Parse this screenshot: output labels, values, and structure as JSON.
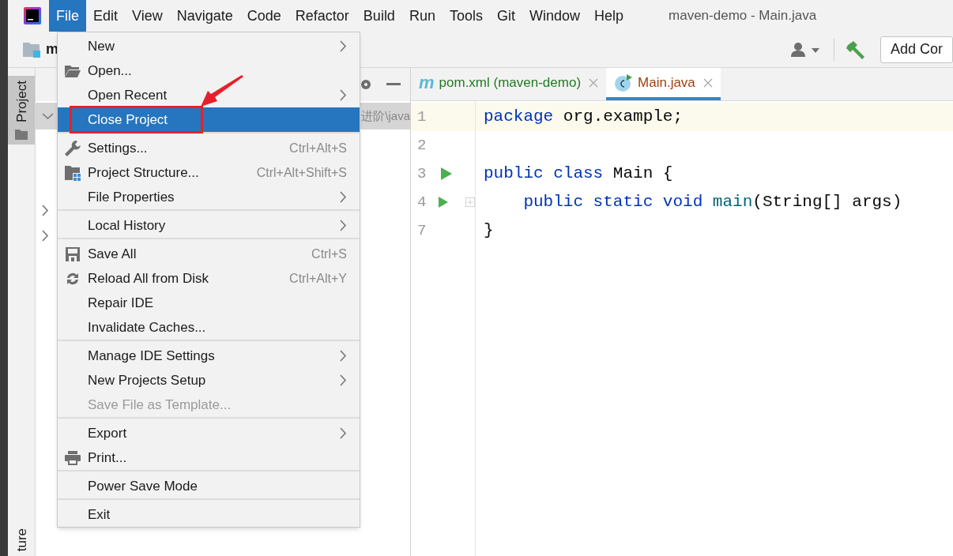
{
  "window": {
    "title": "maven-demo - Main.java"
  },
  "menu_bar": [
    {
      "label": "File",
      "selected": true
    },
    {
      "label": "Edit",
      "selected": false
    },
    {
      "label": "View",
      "selected": false
    },
    {
      "label": "Navigate",
      "selected": false
    },
    {
      "label": "Code",
      "selected": false
    },
    {
      "label": "Refactor",
      "selected": false
    },
    {
      "label": "Build",
      "selected": false
    },
    {
      "label": "Run",
      "selected": false
    },
    {
      "label": "Tools",
      "selected": false
    },
    {
      "label": "Git",
      "selected": false
    },
    {
      "label": "Window",
      "selected": false
    },
    {
      "label": "Help",
      "selected": false
    }
  ],
  "toolbar": {
    "project_name": "m",
    "run_config_button": "Add Cor"
  },
  "side_tabs": [
    {
      "label": "Project",
      "selected": true
    },
    {
      "label": "ture",
      "selected": false
    }
  ],
  "project_panel": {
    "path_fragment": "进阶\\java"
  },
  "file_menu": {
    "groups": [
      [
        {
          "label": "New",
          "submenu": true,
          "disabled": false,
          "selected": false
        },
        {
          "label": "Open...",
          "kind": "folder",
          "submenu": false,
          "disabled": false,
          "selected": false
        },
        {
          "label": "Open Recent",
          "submenu": true,
          "disabled": false,
          "selected": false
        },
        {
          "label": "Close Project",
          "submenu": false,
          "disabled": false,
          "selected": true
        }
      ],
      [
        {
          "label": "Settings...",
          "kind": "wrench",
          "shortcut": "Ctrl+Alt+S",
          "submenu": false,
          "disabled": false,
          "selected": false
        },
        {
          "label": "Project Structure...",
          "kind": "structure",
          "shortcut": "Ctrl+Alt+Shift+S",
          "submenu": false,
          "disabled": false,
          "selected": false
        },
        {
          "label": "File Properties",
          "submenu": true,
          "disabled": false,
          "selected": false
        }
      ],
      [
        {
          "label": "Local History",
          "submenu": true,
          "disabled": false,
          "selected": false
        }
      ],
      [
        {
          "label": "Save All",
          "kind": "save",
          "shortcut": "Ctrl+S",
          "submenu": false,
          "disabled": false,
          "selected": false
        },
        {
          "label": "Reload All from Disk",
          "kind": "reload",
          "shortcut": "Ctrl+Alt+Y",
          "submenu": false,
          "disabled": false,
          "selected": false
        },
        {
          "label": "Repair IDE",
          "submenu": false,
          "disabled": false,
          "selected": false
        },
        {
          "label": "Invalidate Caches...",
          "submenu": false,
          "disabled": false,
          "selected": false
        }
      ],
      [
        {
          "label": "Manage IDE Settings",
          "submenu": true,
          "disabled": false,
          "selected": false
        },
        {
          "label": "New Projects Setup",
          "submenu": true,
          "disabled": false,
          "selected": false
        },
        {
          "label": "Save File as Template...",
          "submenu": false,
          "disabled": true,
          "selected": false
        }
      ],
      [
        {
          "label": "Export",
          "submenu": true,
          "disabled": false,
          "selected": false
        },
        {
          "label": "Print...",
          "kind": "printer",
          "submenu": false,
          "disabled": false,
          "selected": false
        }
      ],
      [
        {
          "label": "Power Save Mode",
          "submenu": false,
          "disabled": false,
          "selected": false
        }
      ],
      [
        {
          "label": "Exit",
          "submenu": false,
          "disabled": false,
          "selected": false
        }
      ]
    ]
  },
  "editor_tabs": [
    {
      "label": "pom.xml (maven-demo)",
      "kind": "maven",
      "icon_label": "m",
      "selected": false
    },
    {
      "label": "Main.java",
      "kind": "java",
      "selected": true
    }
  ],
  "editor_lines": [
    {
      "number": "1",
      "current": true,
      "run": false,
      "fold": false,
      "tokens": [
        {
          "text": "package",
          "kind": "keyword"
        },
        {
          "text": " org.example;",
          "kind": "plain"
        }
      ]
    },
    {
      "number": "2",
      "current": false,
      "run": false,
      "fold": false
    },
    {
      "number": "3",
      "current": false,
      "run": true,
      "fold": false,
      "tokens": [
        {
          "text": "public class",
          "kind": "keyword"
        },
        {
          "text": " Main {",
          "kind": "plain"
        }
      ]
    },
    {
      "number": "4",
      "current": false,
      "run": true,
      "fold": true,
      "tokens": [
        {
          "text": "    public static void ",
          "kind": "keyword"
        },
        {
          "text": "main",
          "kind": "method"
        },
        {
          "text": "(String[] args)",
          "kind": "plain"
        }
      ]
    },
    {
      "number": "7",
      "current": false,
      "run": false,
      "fold": false,
      "tokens": [
        {
          "text": "}",
          "kind": "plain"
        }
      ]
    }
  ]
}
